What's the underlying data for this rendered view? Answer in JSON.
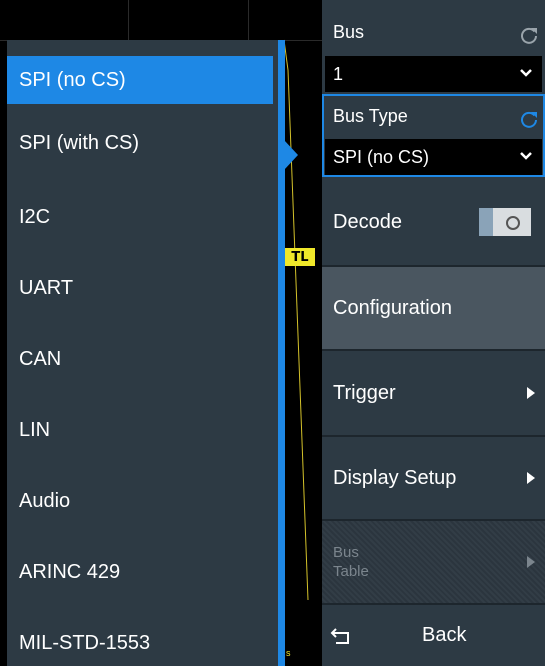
{
  "dropdown": {
    "items": [
      {
        "label": "SPI (no CS)",
        "selected": true
      },
      {
        "label": "SPI (with CS)",
        "selected": false
      },
      {
        "label": "I2C",
        "selected": false
      },
      {
        "label": "UART",
        "selected": false
      },
      {
        "label": "CAN",
        "selected": false
      },
      {
        "label": "LIN",
        "selected": false
      },
      {
        "label": "Audio",
        "selected": false
      },
      {
        "label": "ARINC 429",
        "selected": false
      },
      {
        "label": "MIL-STD-1553",
        "selected": false
      }
    ]
  },
  "scope": {
    "trigger_marker": "TL",
    "tiny_label": "s"
  },
  "menu": {
    "bus_label": "Bus",
    "bus_value": "1",
    "bus_type_label": "Bus Type",
    "bus_type_value": "SPI (no CS)",
    "decode_label": "Decode",
    "decode_state": "off",
    "configuration_label": "Configuration",
    "trigger_label": "Trigger",
    "display_setup_label": "Display Setup",
    "bus_table_label_line1": "Bus",
    "bus_table_label_line2": "Table",
    "back_label": "Back"
  },
  "colors": {
    "accent": "#1e88e5",
    "panel": "#2d3a44",
    "trigger_marker": "#f0e82a",
    "reset_inactive": "#9aa4ab"
  },
  "icons": {
    "bus_reset": "reset-icon",
    "bus_type_reset": "reset-icon",
    "dropdown_chevron": "chevron-down-icon",
    "submenu_arrow": "play-arrow-icon",
    "back": "back-arrow-icon"
  }
}
